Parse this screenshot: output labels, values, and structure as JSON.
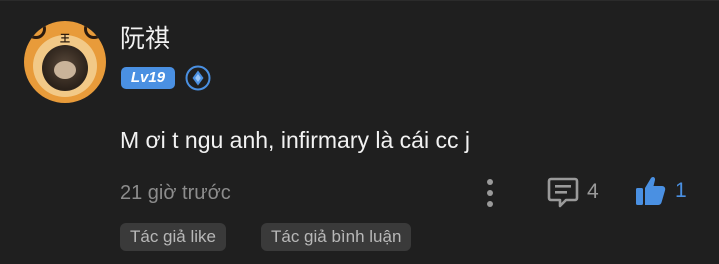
{
  "comment": {
    "username": "阮祺",
    "level": "Lv19",
    "member_badge_icon": "diamond-member-icon",
    "text": "M ơi t ngu anh, infirmary là cái cc j",
    "timestamp": "21 giờ trước",
    "reply_count": "4",
    "like_count": "1",
    "tags": [
      "Tác giả like",
      "Tác giả bình luận"
    ],
    "avatar_seal_text": "王"
  },
  "colors": {
    "background": "#1f1f1f",
    "accent_blue": "#4a90e2",
    "text_primary": "#f2f2f2",
    "text_secondary": "#8c8c8c",
    "tag_background": "#3a3a3a"
  }
}
